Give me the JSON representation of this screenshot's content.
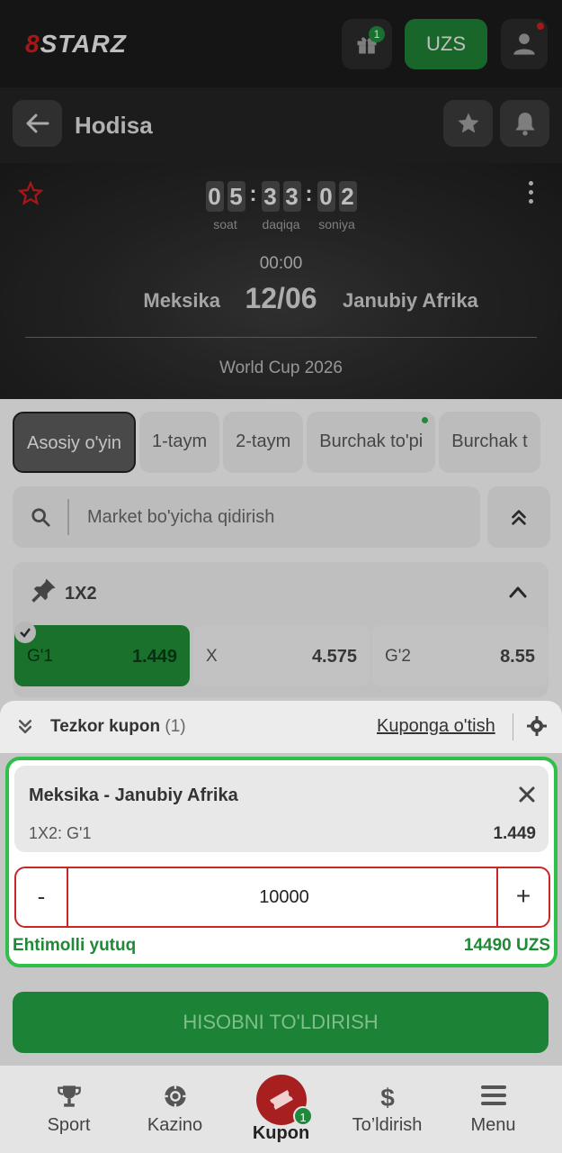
{
  "header": {
    "logo_num": "8",
    "logo_text": "STARZ",
    "gift_badge": "1",
    "currency": "UZS"
  },
  "subheader": {
    "title": "Hodisa"
  },
  "event": {
    "timer": {
      "hours": [
        "0",
        "5"
      ],
      "minutes": [
        "3",
        "3"
      ],
      "seconds": [
        "0",
        "2"
      ],
      "hours_label": "soat",
      "minutes_label": "daqiqa",
      "seconds_label": "soniya"
    },
    "time": "00:00",
    "date": "12/06",
    "team_home": "Meksika",
    "team_away": "Janubiy Afrika",
    "league": "World Cup 2026"
  },
  "tabs": [
    {
      "label": "Asosiy o'yin",
      "active": true
    },
    {
      "label": "1-taym"
    },
    {
      "label": "2-taym"
    },
    {
      "label": "Burchak to'pi",
      "dot": true
    },
    {
      "label": "Burchak t"
    }
  ],
  "search": {
    "placeholder": "Market bo'yicha qidirish"
  },
  "market": {
    "title": "1X2",
    "odds": [
      {
        "name": "G'1",
        "value": "1.449",
        "selected": true
      },
      {
        "name": "X",
        "value": "4.575"
      },
      {
        "name": "G'2",
        "value": "8.55"
      }
    ]
  },
  "coupon": {
    "title": "Tezkor kupon",
    "count": "(1)",
    "link": "Kuponga o'tish",
    "bet": {
      "match": "Meksika - Janubiy Afrika",
      "market": "1X2: G'1",
      "odd": "1.449"
    },
    "stake": {
      "minus": "-",
      "value": "10000",
      "plus": "+"
    },
    "potential_win_label": "Ehtimolli yutuq",
    "potential_win_value": "14490 UZS"
  },
  "deposit_button": "HISOBNI TO'LDIRISH",
  "bottom_nav": {
    "sport": "Sport",
    "kazino": "Kazino",
    "kupon": "Kupon",
    "kupon_badge": "1",
    "toldirish": "To’ldirish",
    "menu": "Menu"
  },
  "colors": {
    "accent_green": "#1e8a35",
    "brand_red": "#c81e1e",
    "highlight_border": "#2fbf4a"
  }
}
